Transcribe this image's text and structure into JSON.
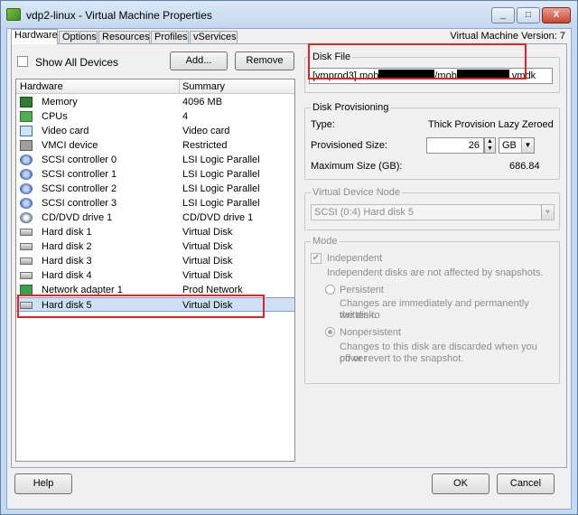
{
  "window": {
    "title": "vdp2-linux - Virtual Machine Properties",
    "controls": {
      "minimize": "_",
      "maximize": "□",
      "close": "X"
    }
  },
  "tabs": [
    {
      "label": "Hardware",
      "active": true
    },
    {
      "label": "Options"
    },
    {
      "label": "Resources"
    },
    {
      "label": "Profiles"
    },
    {
      "label": "vServices"
    }
  ],
  "vm_version": "Virtual Machine Version: 7",
  "hardware": {
    "show_all_devices_label": "Show All Devices",
    "add_label": "Add...",
    "remove_label": "Remove",
    "columns": {
      "hardware": "Hardware",
      "summary": "Summary"
    },
    "items": [
      {
        "icon": "memory-icon",
        "name": "Memory",
        "summary": "4096 MB"
      },
      {
        "icon": "cpu-icon",
        "name": "CPUs",
        "summary": "4"
      },
      {
        "icon": "video-card-icon",
        "name": "Video card",
        "summary": "Video card"
      },
      {
        "icon": "vmci-icon",
        "name": "VMCI device",
        "summary": "Restricted"
      },
      {
        "icon": "scsi-controller-icon",
        "name": "SCSI controller 0",
        "summary": "LSI Logic Parallel"
      },
      {
        "icon": "scsi-controller-icon",
        "name": "SCSI controller 1",
        "summary": "LSI Logic Parallel"
      },
      {
        "icon": "scsi-controller-icon",
        "name": "SCSI controller 2",
        "summary": "LSI Logic Parallel"
      },
      {
        "icon": "scsi-controller-icon",
        "name": "SCSI controller 3",
        "summary": "LSI Logic Parallel"
      },
      {
        "icon": "cd-dvd-icon",
        "name": "CD/DVD drive 1",
        "summary": "CD/DVD drive 1"
      },
      {
        "icon": "hard-disk-icon",
        "name": "Hard disk 1",
        "summary": "Virtual Disk"
      },
      {
        "icon": "hard-disk-icon",
        "name": "Hard disk 2",
        "summary": "Virtual Disk"
      },
      {
        "icon": "hard-disk-icon",
        "name": "Hard disk 3",
        "summary": "Virtual Disk"
      },
      {
        "icon": "hard-disk-icon",
        "name": "Hard disk 4",
        "summary": "Virtual Disk"
      },
      {
        "icon": "network-adapter-icon",
        "name": "Network adapter 1",
        "summary": "Prod Network"
      },
      {
        "icon": "hard-disk-icon",
        "name": "Hard disk 5",
        "summary": "Virtual Disk",
        "selected": true
      }
    ]
  },
  "disk_file": {
    "group_title": "Disk File",
    "path_prefix": "[vmprod3] mob",
    "path_middle": "/mob",
    "path_suffix": ".vmdk"
  },
  "disk_provisioning": {
    "group_title": "Disk Provisioning",
    "type_label": "Type:",
    "type_value": "Thick Provision Lazy Zeroed",
    "provisioned_size_label": "Provisioned Size:",
    "provisioned_size_value": "26",
    "unit": "GB",
    "max_size_label": "Maximum Size (GB):",
    "max_size_value": "686.84"
  },
  "virtual_device_node": {
    "group_title": "Virtual Device Node",
    "value": "SCSI (0:4) Hard disk 5"
  },
  "mode": {
    "group_title": "Mode",
    "independent_label": "Independent",
    "independent_desc": "Independent disks are not affected by snapshots.",
    "persistent_label": "Persistent",
    "persistent_desc_1": "Changes are immediately and permanently written to",
    "persistent_desc_2": "the disk.",
    "nonpersistent_label": "Nonpersistent",
    "nonpersistent_desc_1": "Changes to this disk are discarded when you power",
    "nonpersistent_desc_2": "off or revert to the snapshot."
  },
  "footer": {
    "help_label": "Help",
    "ok_label": "OK",
    "cancel_label": "Cancel"
  },
  "colors": {
    "highlight_box": "#e02424",
    "selection": "#cde0f5"
  }
}
